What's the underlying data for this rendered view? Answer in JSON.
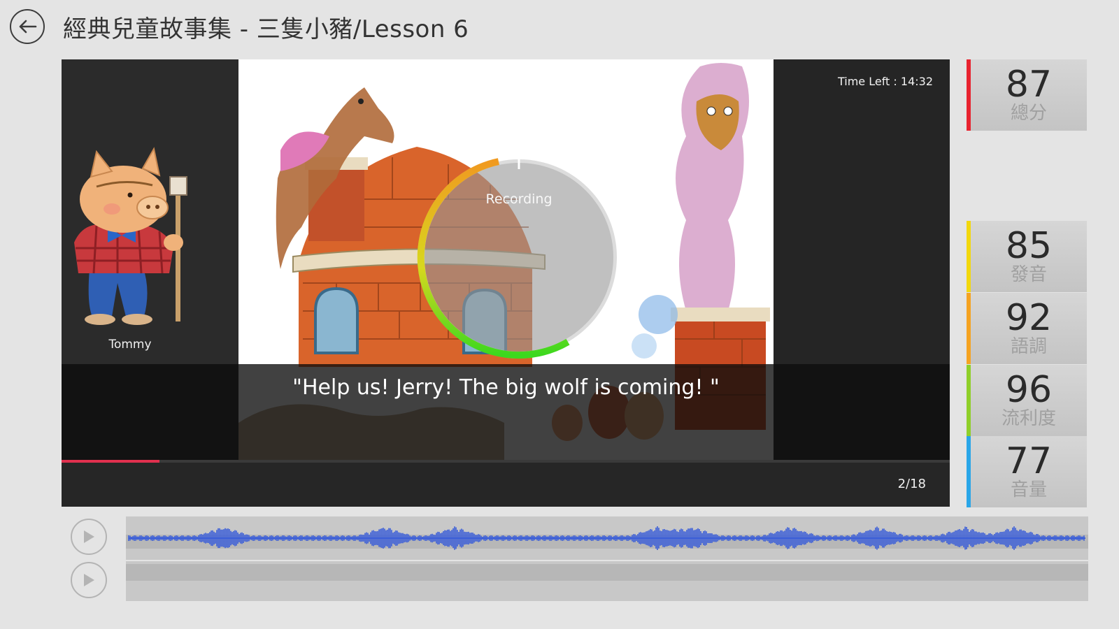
{
  "header": {
    "title": "經典兒童故事集 - 三隻小豬/Lesson 6"
  },
  "player": {
    "character_name": "Tommy",
    "time_left": "Time Left : 14:32",
    "recording_label": "Recording",
    "recording_progress": 0.55,
    "subtitle": "\"Help us! Jerry! The big wolf is coming! \"",
    "page_counter": "2/18",
    "progress_fraction": 0.11
  },
  "scores": [
    {
      "value": "87",
      "label": "總分",
      "color": "#e8232f"
    },
    {
      "value": "85",
      "label": "發音",
      "color": "#f2d80e"
    },
    {
      "value": "92",
      "label": "語調",
      "color": "#f5a321"
    },
    {
      "value": "96",
      "label": "流利度",
      "color": "#8fcf2a"
    },
    {
      "value": "77",
      "label": "音量",
      "color": "#2aa6e8"
    }
  ],
  "audio": {
    "waveform_color": "#3b5ed8"
  },
  "icons": {
    "back": "back-arrow-icon",
    "play": "play-icon"
  }
}
